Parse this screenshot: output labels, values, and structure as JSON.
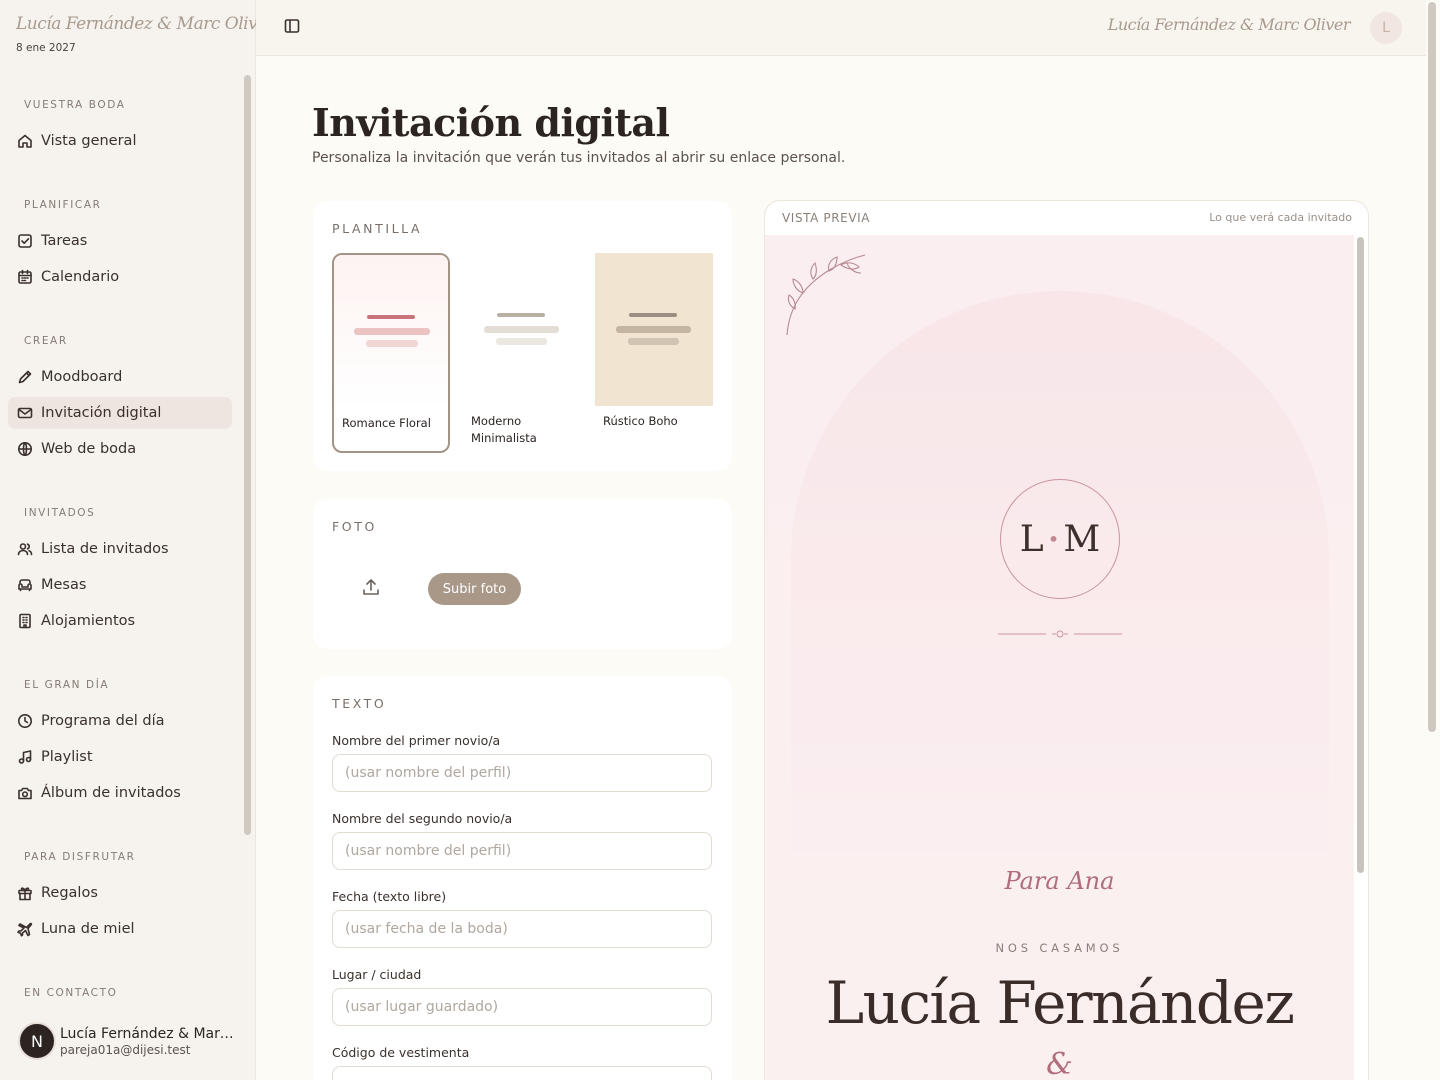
{
  "brand": {
    "couple": "Lucía Fernández & Marc Oliver",
    "date": "8 ene 2027"
  },
  "topbar": {
    "couple": "Lucía Fernández & Marc Oliver",
    "avatar": "L"
  },
  "nav": {
    "groups": [
      {
        "title": "VUESTRA BODA",
        "items": [
          {
            "label": "Vista general",
            "icon": "home-icon"
          }
        ]
      },
      {
        "title": "PLANIFICAR",
        "items": [
          {
            "label": "Tareas",
            "icon": "checkbox-icon"
          },
          {
            "label": "Calendario",
            "icon": "calendar-icon"
          }
        ]
      },
      {
        "title": "CREAR",
        "items": [
          {
            "label": "Moodboard",
            "icon": "pencil-icon"
          },
          {
            "label": "Invitación digital",
            "icon": "mail-icon",
            "active": true
          },
          {
            "label": "Web de boda",
            "icon": "globe-icon"
          }
        ]
      },
      {
        "title": "INVITADOS",
        "items": [
          {
            "label": "Lista de invitados",
            "icon": "users-icon"
          },
          {
            "label": "Mesas",
            "icon": "sofa-icon"
          },
          {
            "label": "Alojamientos",
            "icon": "building-icon"
          }
        ]
      },
      {
        "title": "EL GRAN DÍA",
        "items": [
          {
            "label": "Programa del día",
            "icon": "clock-icon"
          },
          {
            "label": "Playlist",
            "icon": "music-icon"
          },
          {
            "label": "Álbum de invitados",
            "icon": "camera-icon"
          }
        ]
      },
      {
        "title": "PARA DISFRUTAR",
        "items": [
          {
            "label": "Regalos",
            "icon": "gift-icon"
          },
          {
            "label": "Luna de miel",
            "icon": "plane-icon"
          }
        ]
      },
      {
        "title": "EN CONTACTO",
        "items": []
      }
    ]
  },
  "user": {
    "initial": "N",
    "name": "Lucía Fernández & Marc Oliver",
    "email": "pareja01a@dijesi.test"
  },
  "page": {
    "title": "Invitación digital",
    "subtitle": "Personaliza la invitación que verán tus invitados al abrir su enlace personal."
  },
  "template_card": {
    "title": "PLANTILLA",
    "templates": [
      {
        "label": "Romance Floral",
        "selected": true,
        "bg": "#fdf3f2",
        "line_colors": [
          "#c9747c",
          "#ecc3c3",
          "#f2d6d4"
        ]
      },
      {
        "label": "Moderno Minimalista",
        "selected": false,
        "bg": "#ffffff",
        "line_colors": [
          "#b9afa3",
          "#e3ddd6",
          "#ebe7e1"
        ]
      },
      {
        "label": "Rústico Boho",
        "selected": false,
        "bg": "#f1e5d2",
        "line_colors": [
          "#9c8e80",
          "#c4b5a3",
          "#d2c4b2"
        ]
      }
    ]
  },
  "photo_card": {
    "title": "FOTO",
    "upload_label": "Subir foto"
  },
  "text_card": {
    "title": "TEXTO",
    "fields": [
      {
        "label": "Nombre del primer novio/a",
        "placeholder": "(usar nombre del perfil)"
      },
      {
        "label": "Nombre del segundo novio/a",
        "placeholder": "(usar nombre del perfil)"
      },
      {
        "label": "Fecha (texto libre)",
        "placeholder": "(usar fecha de la boda)"
      },
      {
        "label": "Lugar / ciudad",
        "placeholder": "(usar lugar guardado)"
      },
      {
        "label": "Código de vestimenta",
        "placeholder": ""
      }
    ]
  },
  "preview": {
    "header_left": "VISTA PREVIA",
    "header_right": "Lo que verá cada invitado",
    "monogram_left": "L",
    "monogram_right": "M",
    "greeting": "Para Ana",
    "announcement": "NOS CASAMOS",
    "name_one": "Lucía Fernández",
    "ampersand": "&"
  }
}
